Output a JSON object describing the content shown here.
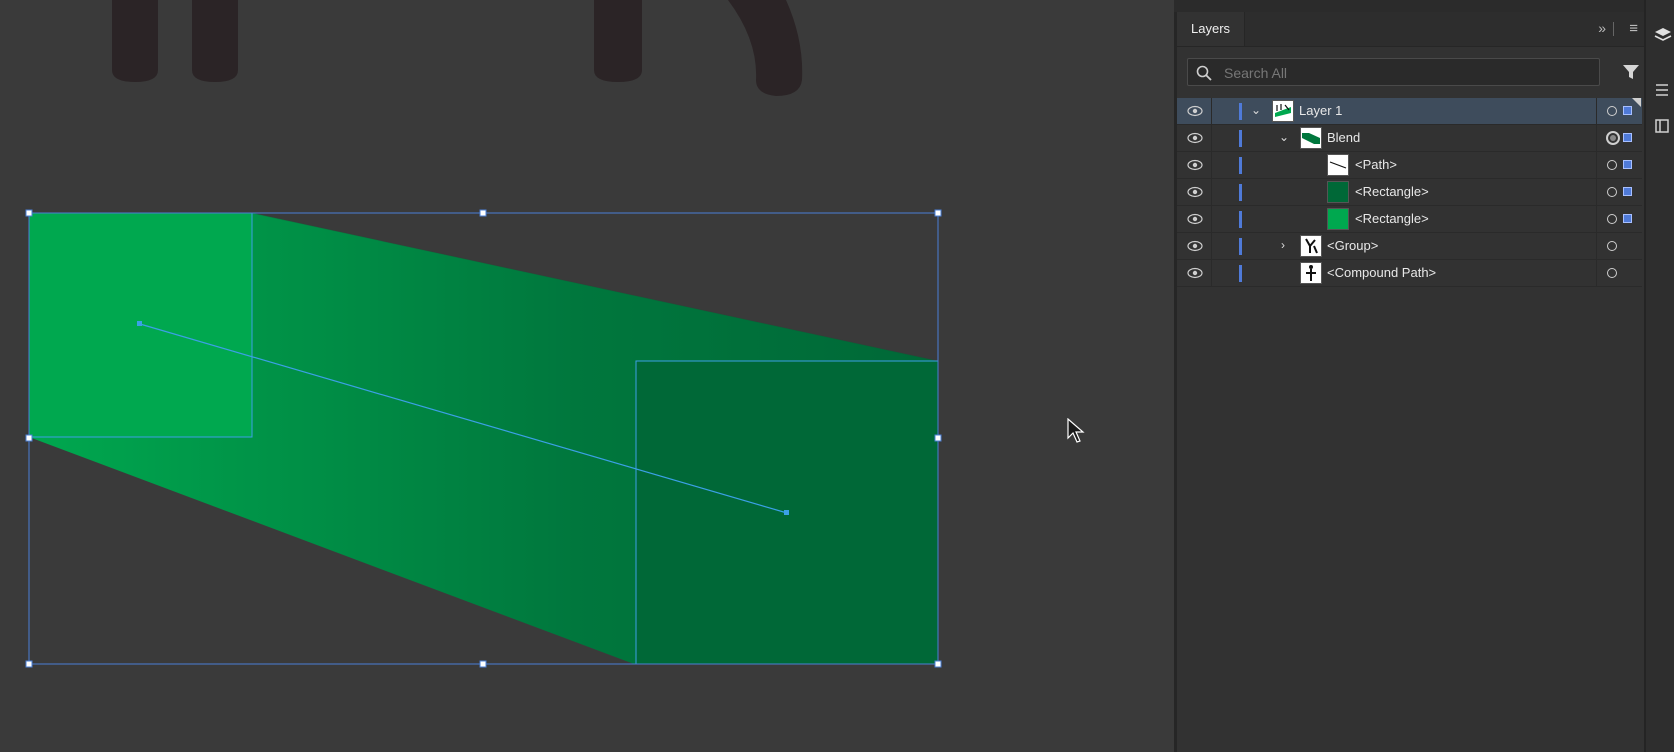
{
  "panel": {
    "tab_label": "Layers",
    "collapse_glyph": "»",
    "menu_glyph": "≡",
    "search_placeholder": "Search All"
  },
  "layers": [
    {
      "name": "Layer 1",
      "expanded": true,
      "selected": true,
      "thumb": "layer-thumb-icon"
    },
    {
      "name": "Blend",
      "expanded": true,
      "selected": false,
      "thumb": "blend-thumb-icon"
    },
    {
      "name": "<Path>",
      "selected": false,
      "thumb": "path-thumb-icon"
    },
    {
      "name": "<Rectangle>",
      "selected": false,
      "thumb": "dark-green-swatch"
    },
    {
      "name": "<Rectangle>",
      "selected": false,
      "thumb": "green-swatch"
    },
    {
      "name": "<Group>",
      "expanded": false,
      "selected": false,
      "thumb": "group-thumb-icon"
    },
    {
      "name": "<Compound Path>",
      "selected": false,
      "thumb": "compound-thumb-icon"
    }
  ],
  "colors": {
    "canvas_bg": "#3a3a3a",
    "green_light": "#00a84f",
    "green_dark": "#006837",
    "selection_blue": "#4a90e2",
    "layer_color": "#4f7ad8"
  }
}
